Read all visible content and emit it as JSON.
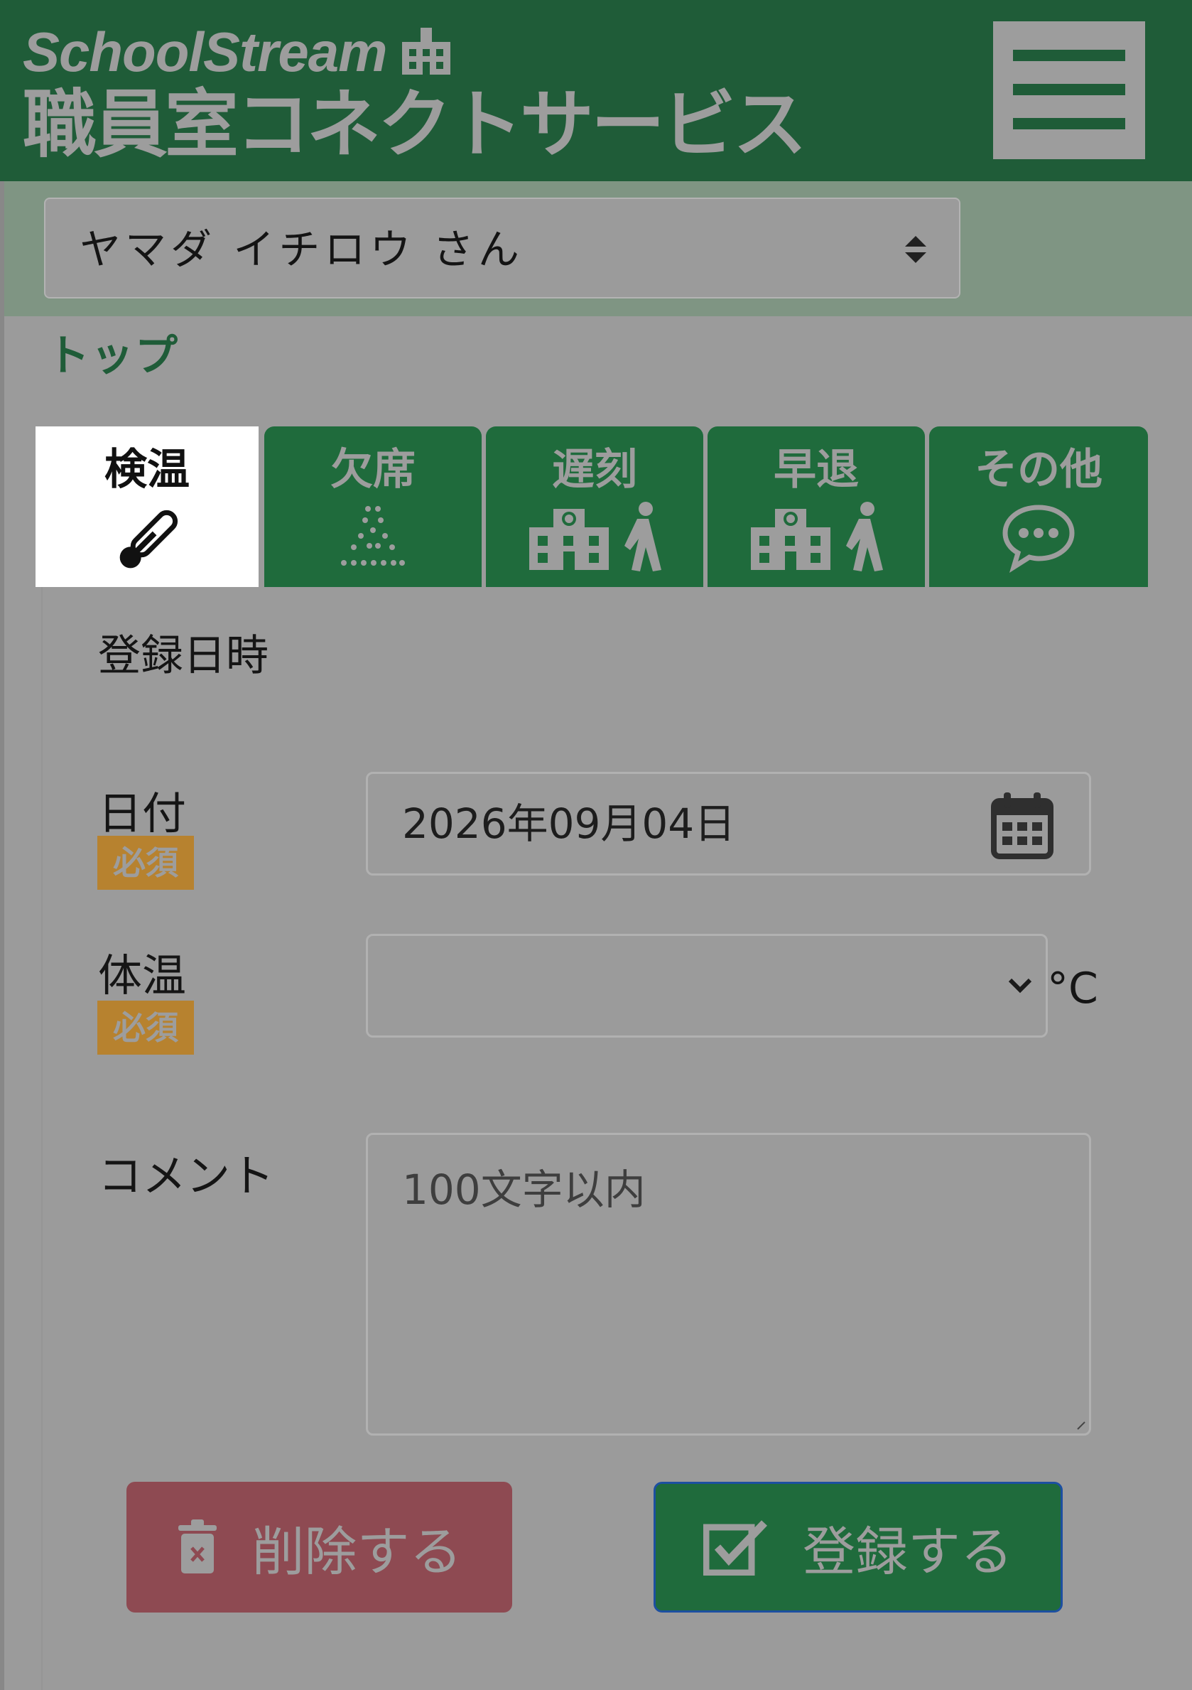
{
  "header": {
    "brand_en": "SchoolStream",
    "service_name": "職員室コネクトサービス",
    "logo_icon": "school-building-icon",
    "menu_icon": "hamburger-menu-icon",
    "colors": {
      "header_bg": "#1f5c38",
      "brand_text": "#9d9d9d"
    }
  },
  "user_selector": {
    "selected": "ヤマダ イチロウ さん"
  },
  "breadcrumb": {
    "top": "トップ"
  },
  "tabs": [
    {
      "label": "検温",
      "icon": "thermometer-icon",
      "active": true
    },
    {
      "label": "欠席",
      "icon": "absence-dots-icon",
      "active": false
    },
    {
      "label": "遅刻",
      "icon": "school-walking-icon",
      "active": false
    },
    {
      "label": "早退",
      "icon": "school-walking-icon",
      "active": false
    },
    {
      "label": "その他",
      "icon": "speech-bubble-icon",
      "active": false
    }
  ],
  "form": {
    "section_title": "登録日時",
    "date": {
      "label": "日付",
      "required": "必須",
      "value": "2026年09月04日",
      "icon": "calendar-icon"
    },
    "temperature": {
      "label": "体温",
      "required": "必須",
      "value": "",
      "unit": "°C"
    },
    "comment": {
      "label": "コメント",
      "placeholder": "100文字以内"
    }
  },
  "buttons": {
    "delete": {
      "label": "削除する",
      "icon": "trash-icon",
      "color": "#8e4a52"
    },
    "submit": {
      "label": "登録する",
      "icon": "checkbox-check-icon",
      "color": "#1f6b3c"
    }
  }
}
